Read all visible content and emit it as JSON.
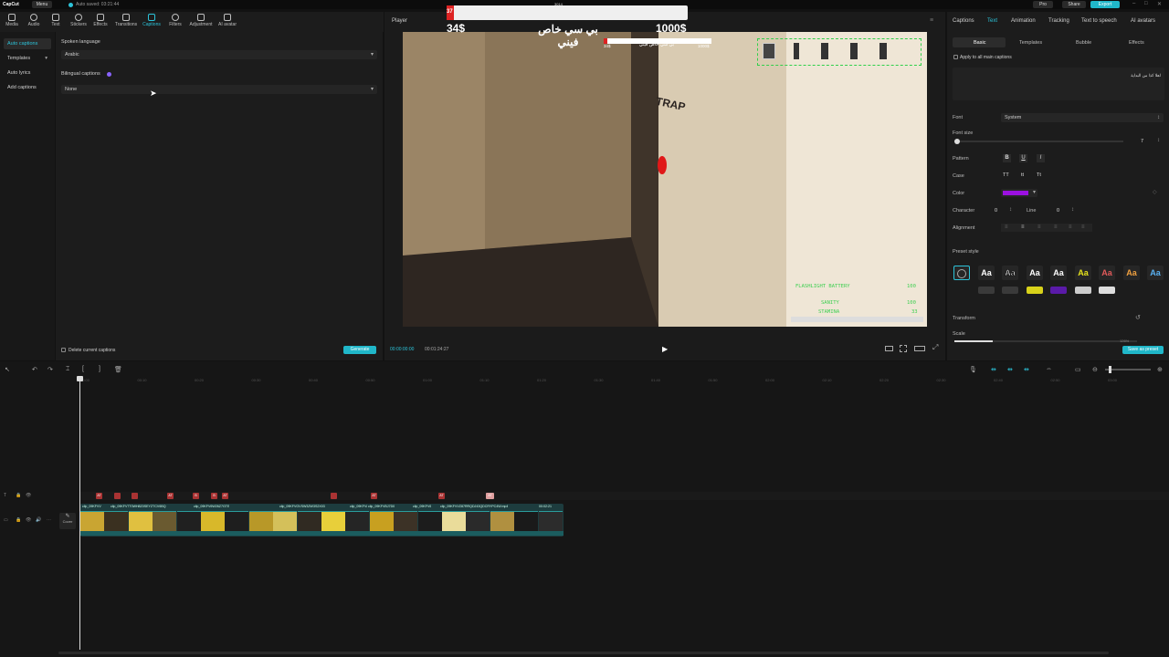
{
  "app": {
    "logo": "CapCut",
    "menu": "Menu",
    "autosave": "Auto saved: 03:21:44",
    "pro": "Pro",
    "share": "Share",
    "export": "Export"
  },
  "toolbar": [
    {
      "label": "Media",
      "icon": "media-icon"
    },
    {
      "label": "Audio",
      "icon": "audio-icon"
    },
    {
      "label": "Text",
      "icon": "text-icon"
    },
    {
      "label": "Stickers",
      "icon": "stickers-icon"
    },
    {
      "label": "Effects",
      "icon": "effects-icon"
    },
    {
      "label": "Transitions",
      "icon": "transitions-icon"
    },
    {
      "label": "Captions",
      "icon": "captions-icon",
      "active": true
    },
    {
      "label": "Filters",
      "icon": "filters-icon"
    },
    {
      "label": "Adjustment",
      "icon": "adjustment-icon"
    },
    {
      "label": "AI avatar",
      "icon": "ai-avatar-icon"
    }
  ],
  "leftnav": [
    "Auto captions",
    "Templates",
    "Auto lyrics",
    "Add captions"
  ],
  "captions": {
    "spoken_label": "Spoken language",
    "spoken_value": "Arabic",
    "bilingual_label": "Bilingual captions",
    "bilingual_value": "None",
    "delete_label": "Delete current captions",
    "generate": "Generate"
  },
  "player": {
    "title": "Player",
    "time_current": "00:00:00:00",
    "time_total": "00:01:24:27",
    "overlay_arabic": "بي سي خاص فيني",
    "overlay_small_arabic": "بي سي خاص فيني",
    "money_left": "34$",
    "money_right": "1000$",
    "money_small_left": "34$",
    "money_small_right": "1000$",
    "top_number": "3014",
    "bar_num": "37",
    "graffiti": "TRAP",
    "hud_battery_label": "FLASHLIGHT BATTERY",
    "hud_battery_value": "100",
    "hud_sanity_label": "SANITY",
    "hud_sanity_value": "100",
    "hud_stamina_label": "STAMINA",
    "hud_stamina_value": "33"
  },
  "rightpanel": {
    "tabs": [
      "Captions",
      "Text",
      "Animation",
      "Tracking",
      "Text to speech",
      "AI avatars"
    ],
    "subtabs": [
      "Basic",
      "Templates",
      "Bubble",
      "Effects"
    ],
    "apply_all": "Apply to all main captions",
    "text_preview": "اهلا كذا من البداية",
    "font_label": "Font",
    "font_value": "System",
    "font_size_label": "Font size",
    "font_size_value": "7",
    "pattern_label": "Pattern",
    "pattern_bold": "B",
    "pattern_underline": "U",
    "pattern_italic": "I",
    "case_label": "Case",
    "case_upper": "TT",
    "case_lower": "tt",
    "case_title": "Tt",
    "color_label": "Color",
    "color_value": "#9b10e0",
    "character_label": "Character",
    "character_value": "0",
    "line_label": "Line",
    "line_value": "0",
    "alignment_label": "Alignment",
    "preset_label": "Preset style",
    "presets": [
      "Aa",
      "Aa",
      "Aa",
      "Aa",
      "Aa",
      "Aa",
      "Aa",
      "Aa"
    ],
    "transform_label": "Transform",
    "scale_label": "Scale",
    "scale_value": "126%",
    "save_preset": "Save as preset"
  },
  "timeline": {
    "ticks": [
      "00:00",
      "00:10",
      "00:20",
      "00:30",
      "00:40",
      "00:50",
      "01:00",
      "01:10",
      "01:20",
      "01:30",
      "01:40",
      "01:50",
      "02:00",
      "02:10",
      "02:20",
      "02:30",
      "02:40",
      "02:50",
      "03:00"
    ],
    "cover_label": "Cover",
    "clip_names": [
      "clip_09KFVV",
      "clip_09KFV7T0WH8Z0SEYZTCV6BQ",
      "clip_09KFV6W26Z7GTE",
      "clip_09KFVGVSW3ZW3S2X03",
      "clip_09KFV8",
      "clip_09KFVBJ7D0",
      "clip_09KFV6",
      "clip_09KFVVZ87RRQDJ43QDCRYPC4W.mp4",
      "00:02:21"
    ],
    "markers": [
      "AT",
      "",
      "",
      "AT",
      "B",
      "B",
      "AT",
      "",
      "AT",
      "AT",
      "AT"
    ]
  }
}
